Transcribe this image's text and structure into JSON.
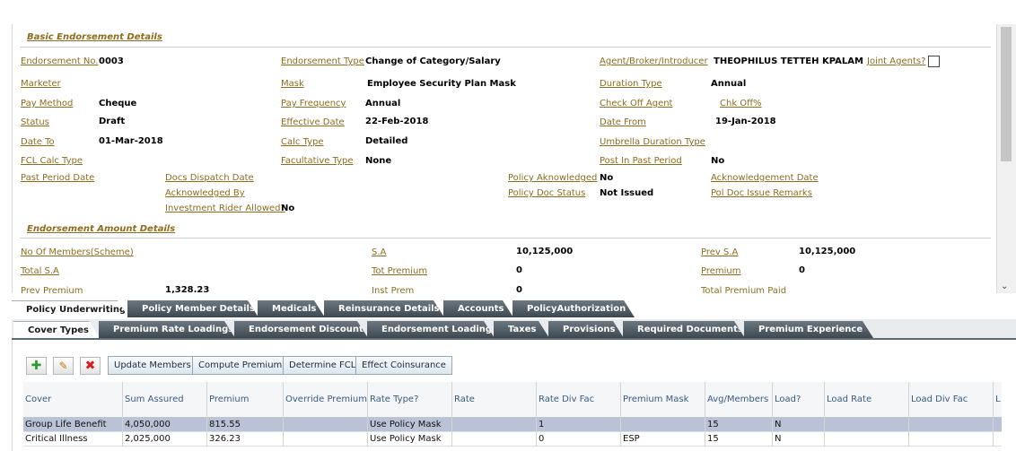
{
  "sections": {
    "basic": "Basic Endorsement Details",
    "amount": "Endorsement Amount Details"
  },
  "basic": {
    "endorsement_no": {
      "label": "Endorsement No.",
      "value": "0003"
    },
    "endorsement_type": {
      "label": "Endorsement Type",
      "value": "Change of Category/Salary"
    },
    "agent": {
      "label": "Agent/Broker/Introducer",
      "value": "THEOPHILUS TETTEH KPALAM"
    },
    "joint_agents": {
      "label": "Joint Agents?"
    },
    "marketer": {
      "label": "Marketer",
      "value": ""
    },
    "mask": {
      "label": "Mask",
      "value": "Employee Security Plan Mask"
    },
    "duration_type": {
      "label": "Duration Type",
      "value": "Annual"
    },
    "pay_method": {
      "label": "Pay Method",
      "value": "Cheque"
    },
    "pay_frequency": {
      "label": "Pay Frequency",
      "value": "Annual"
    },
    "check_off_agent": {
      "label": "Check Off Agent",
      "value": ""
    },
    "chk_off": {
      "label": "Chk Off%"
    },
    "status": {
      "label": "Status",
      "value": "Draft"
    },
    "effective_date": {
      "label": "Effective Date",
      "value": "22-Feb-2018"
    },
    "date_from": {
      "label": "Date From",
      "value": "19-Jan-2018"
    },
    "date_to": {
      "label": "Date To",
      "value": "01-Mar-2018"
    },
    "calc_type": {
      "label": "Calc Type",
      "value": "Detailed"
    },
    "umbrella_duration_type": {
      "label": "Umbrella Duration Type",
      "value": ""
    },
    "fcl_calc_type": {
      "label": "FCL Calc Type",
      "value": ""
    },
    "facultative_type": {
      "label": "Facultative Type",
      "value": "None"
    },
    "post_in_past_period": {
      "label": "Post In Past Period",
      "value": "No"
    },
    "past_period_date": {
      "label": "Past Period Date",
      "value": ""
    },
    "docs_dispatch_date": {
      "label": "Docs Dispatch Date",
      "value": ""
    },
    "policy_acknowledged": {
      "label": "Policy Aknowledged",
      "value": "No"
    },
    "acknowledgement_date": {
      "label": "Acknowledgement Date",
      "value": ""
    },
    "acknowledged_by": {
      "label": "Acknowledged By",
      "value": ""
    },
    "policy_doc_status": {
      "label": "Policy Doc Status",
      "value": "Not Issued"
    },
    "pol_doc_issue_remarks": {
      "label": "Pol Doc Issue Remarks",
      "value": ""
    },
    "investment_rider": {
      "label": "Investment Rider Allowed?",
      "value": "No"
    }
  },
  "amount": {
    "no_of_members": {
      "label": "No Of Members(Scheme)",
      "value": ""
    },
    "sa": {
      "label": "S.A",
      "value": "10,125,000"
    },
    "prev_sa": {
      "label": "Prev S.A",
      "value": "10,125,000"
    },
    "total_sa": {
      "label": "Total S.A",
      "value": ""
    },
    "tot_premium": {
      "label": "Tot Premium",
      "value": "0"
    },
    "premium": {
      "label": "Premium",
      "value": "0"
    },
    "prev_premium": {
      "label": "Prev Premium",
      "value": "1,328.23"
    },
    "inst_prem": {
      "label": "Inst Prem",
      "value": "0"
    },
    "total_premium_paid": {
      "label": "Total Premium Paid",
      "value": ""
    }
  },
  "tabs_primary": [
    "Policy Underwriting",
    "Policy Member Details",
    "Medicals",
    "Reinsurance Details",
    "Accounts",
    "PolicyAuthorization"
  ],
  "tabs_secondary": [
    "Cover Types",
    "Premium Rate Loadings",
    "Endorsement Discounts",
    "Endorsement Loading",
    "Taxes",
    "Provisions",
    "Required Documents",
    "Premium Experience"
  ],
  "toolbar": {
    "add_icon": "plus-icon",
    "edit_icon": "pencil-icon",
    "delete_icon": "x-icon",
    "update_members": "Update Members",
    "compute_premium": "Compute Premium",
    "determine_fcl": "Determine FCL",
    "effect_coinsurance": "Effect Coinsurance"
  },
  "grid": {
    "columns": [
      "Cover",
      "Sum Assured",
      "Premium",
      "Override Premium",
      "Rate Type?",
      "Rate",
      "Rate Div Fac",
      "Premium Mask",
      "Avg/Members",
      "Load?",
      "Load Rate",
      "Load Div Fac",
      "L"
    ],
    "rows": [
      [
        "Group Life Benefit",
        "4,050,000",
        "815.55",
        "",
        "Use Policy Mask",
        "",
        "1",
        "",
        "15",
        "N",
        "",
        "",
        ""
      ],
      [
        "Critical Illness",
        "2,025,000",
        "326.23",
        "",
        "Use Policy Mask",
        "",
        "0",
        "ESP",
        "15",
        "N",
        "",
        "",
        ""
      ]
    ]
  },
  "colors": {
    "link": "#8a6d1f",
    "tab_dark": "#4b555e",
    "selected_row": "#b9c2d6"
  }
}
